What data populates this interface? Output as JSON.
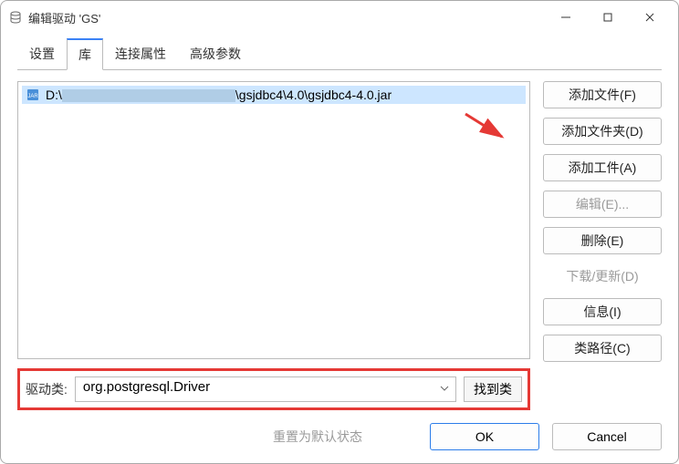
{
  "window": {
    "title": "编辑驱动 'GS'"
  },
  "tabs": {
    "settings": "设置",
    "library": "库",
    "connection": "连接属性",
    "advanced": "高级参数"
  },
  "file": {
    "prefix": "D:\\",
    "suffix": "\\gsjdbc4\\4.0\\gsjdbc4-4.0.jar"
  },
  "driver": {
    "label": "驱动类:",
    "value": "org.postgresql.Driver",
    "find": "找到类"
  },
  "side": {
    "add_file": "添加文件(F)",
    "add_folder": "添加文件夹(D)",
    "add_artifact": "添加工件(A)",
    "edit": "编辑(E)...",
    "delete": "删除(E)",
    "download": "下载/更新(D)",
    "info": "信息(I)",
    "classpath": "类路径(C)"
  },
  "footer": {
    "reset": "重置为默认状态",
    "ok": "OK",
    "cancel": "Cancel"
  }
}
